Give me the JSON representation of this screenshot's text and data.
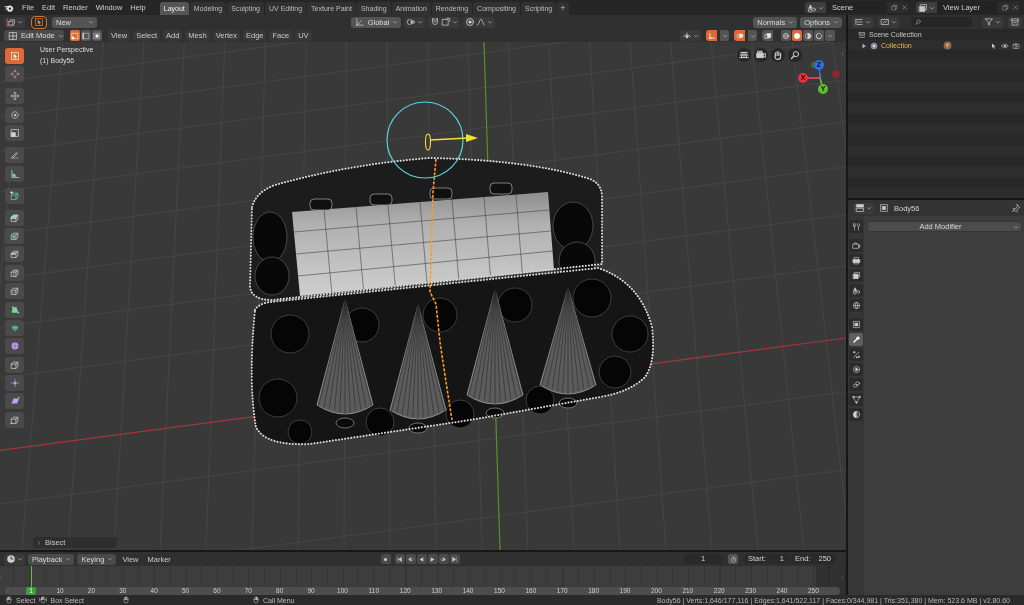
{
  "top_bar": {
    "menus": [
      "File",
      "Edit",
      "Render",
      "Window",
      "Help"
    ],
    "workspaces": [
      {
        "label": "Layout",
        "selected": true
      },
      {
        "label": "Modeling",
        "selected": false
      },
      {
        "label": "Sculpting",
        "selected": false
      },
      {
        "label": "UV Editing",
        "selected": false
      },
      {
        "label": "Texture Paint",
        "selected": false
      },
      {
        "label": "Shading",
        "selected": false
      },
      {
        "label": "Animation",
        "selected": false
      },
      {
        "label": "Rendering",
        "selected": false
      },
      {
        "label": "Compositing",
        "selected": false
      },
      {
        "label": "Scripting",
        "selected": false
      }
    ],
    "add_workspace": "+",
    "scene": "Scene",
    "view_layer": "View Layer"
  },
  "tool_settings": {
    "brush": "New",
    "orientation": "Global",
    "normals": "Normals",
    "options": "Options"
  },
  "viewport_header": {
    "mode": "Edit Mode",
    "select_modes": [
      {
        "kind": "vertex",
        "selected": true
      },
      {
        "kind": "edge",
        "selected": false
      },
      {
        "kind": "face",
        "selected": false
      }
    ],
    "menus": [
      "View",
      "Select",
      "Add",
      "Mesh",
      "Vertex",
      "Edge",
      "Face",
      "UV"
    ],
    "toggles": [
      {
        "kind": "gizmos",
        "on": true
      },
      {
        "kind": "overlays",
        "on": true
      },
      {
        "kind": "xray",
        "on": false
      }
    ],
    "shading": [
      {
        "kind": "wireframe",
        "selected": false
      },
      {
        "kind": "solid",
        "selected": true
      },
      {
        "kind": "material",
        "selected": false
      },
      {
        "kind": "rendered",
        "selected": false
      }
    ]
  },
  "viewport": {
    "view_name": "User Perspective",
    "object_label": "(1) Body56",
    "tool_groups": [
      {
        "tools": [
          {
            "kind": "select_box",
            "selected": true
          },
          {
            "kind": "cursor",
            "selected": false
          }
        ]
      },
      {
        "tools": [
          {
            "kind": "move",
            "selected": false
          },
          {
            "kind": "rotate",
            "selected": false
          },
          {
            "kind": "scale",
            "selected": false
          }
        ]
      },
      {
        "tools": [
          {
            "kind": "annotate",
            "selected": false
          },
          {
            "kind": "measure",
            "selected": false
          }
        ]
      },
      {
        "tools": [
          {
            "kind": "add_cube",
            "selected": false
          }
        ]
      },
      {
        "tools": [
          {
            "kind": "extrude",
            "selected": false
          },
          {
            "kind": "inset",
            "selected": false
          },
          {
            "kind": "bevel",
            "selected": false
          },
          {
            "kind": "loop_cut",
            "selected": false
          },
          {
            "kind": "knife",
            "selected": false
          },
          {
            "kind": "poly_build",
            "selected": false
          },
          {
            "kind": "spin",
            "selected": false
          },
          {
            "kind": "smooth",
            "selected": false
          },
          {
            "kind": "edge_slide",
            "selected": false
          },
          {
            "kind": "shrink_fatten",
            "selected": false
          },
          {
            "kind": "shear",
            "selected": false
          },
          {
            "kind": "rip_region",
            "selected": false
          }
        ]
      }
    ],
    "axes": [
      {
        "label": "X",
        "color": "#e8313d"
      },
      {
        "label": "Y",
        "color": "#5fbf2a"
      },
      {
        "label": "Z",
        "color": "#2f6ce8"
      }
    ],
    "last_operator": "Bisect"
  },
  "outliner": {
    "items": [
      {
        "label": "Scene Collection",
        "children": [
          {
            "label": "Collection",
            "expanded": false,
            "active": true
          }
        ]
      }
    ]
  },
  "properties": {
    "object_name": "Body56",
    "tab_groups": [
      {
        "tabs": [
          {
            "kind": "tool",
            "selected": false
          }
        ]
      },
      {
        "tabs": [
          {
            "kind": "render",
            "selected": false
          },
          {
            "kind": "output",
            "selected": false
          },
          {
            "kind": "view_layer",
            "selected": false
          },
          {
            "kind": "scene",
            "selected": false
          },
          {
            "kind": "world",
            "selected": false
          }
        ]
      },
      {
        "tabs": [
          {
            "kind": "object",
            "selected": false
          },
          {
            "kind": "modifiers",
            "selected": true
          },
          {
            "kind": "particles",
            "selected": false
          },
          {
            "kind": "physics",
            "selected": false
          },
          {
            "kind": "constraints",
            "selected": false
          },
          {
            "kind": "data",
            "selected": false
          },
          {
            "kind": "material",
            "selected": false
          }
        ]
      }
    ],
    "add_modifier": "Add Modifier"
  },
  "timeline": {
    "menus": [
      {
        "label": "Playback",
        "kind": "dropdown"
      },
      {
        "label": "Keying",
        "kind": "dropdown"
      },
      {
        "label": "View",
        "kind": "menu"
      },
      {
        "label": "Marker",
        "kind": "menu"
      }
    ],
    "current_frame": "1",
    "start_label": "Start:",
    "start": "1",
    "end_label": "End:",
    "end": "250",
    "playhead": "1",
    "ruler": [
      "10",
      "20",
      "30",
      "40",
      "50",
      "60",
      "70",
      "80",
      "90",
      "100",
      "110",
      "120",
      "130",
      "140",
      "150",
      "160",
      "170",
      "180",
      "190",
      "200",
      "210",
      "220",
      "230",
      "240",
      "250"
    ]
  },
  "status_bar": {
    "hints": [
      {
        "kind": "left",
        "label": "Select"
      },
      {
        "kind": "drag",
        "label": "Box Select"
      },
      {
        "kind": "middle"
      },
      {
        "kind": "right",
        "label": "Call Menu"
      }
    ],
    "stats": "Body56 | Verts:1,646/177,116 | Edges:1,641/522,117 | Faces:0/344,981 | Tris:351,380 | Mem: 523.6 MB | v2.80.60"
  }
}
